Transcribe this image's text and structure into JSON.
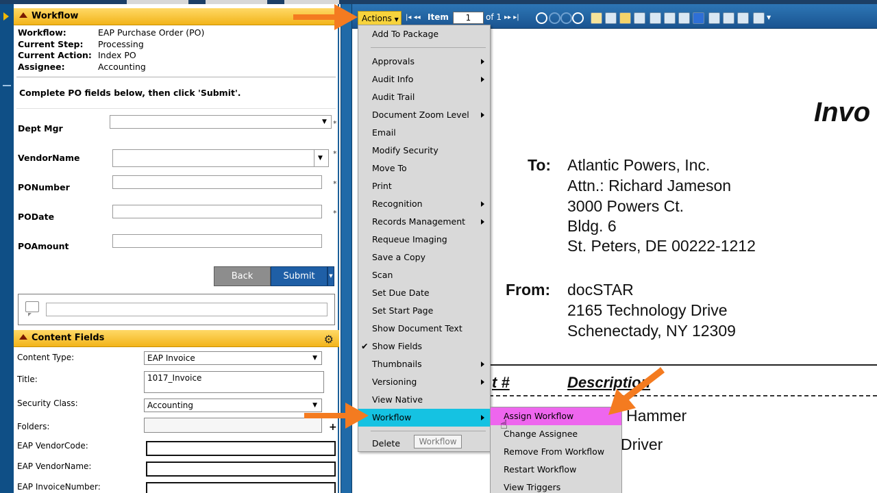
{
  "colors": {
    "accent_gold": "#f2b41a",
    "brand_blue": "#1f5fa6",
    "menu_highlight": "#15c2e2",
    "submenu_highlight": "#ee66ee",
    "arrow_orange": "#f47b20"
  },
  "workflow_panel": {
    "title": "Workflow",
    "info": [
      {
        "key": "Workflow:",
        "value": "EAP Purchase Order (PO)"
      },
      {
        "key": "Current Step:",
        "value": "Processing"
      },
      {
        "key": "Current Action:",
        "value": "Index PO"
      },
      {
        "key": "Assignee:",
        "value": "Accounting"
      }
    ],
    "instruction": "Complete PO fields below, then click 'Submit'.",
    "fields": [
      {
        "label": "Dept Mgr",
        "value": ""
      },
      {
        "label": "VendorName",
        "value": ""
      },
      {
        "label": "PONumber",
        "value": ""
      },
      {
        "label": "PODate",
        "value": ""
      },
      {
        "label": "POAmount",
        "value": ""
      }
    ],
    "required_mark": "*",
    "back_label": "Back",
    "submit_label": "Submit",
    "comment_value": ""
  },
  "content_panel": {
    "title": "Content Fields",
    "fields": [
      {
        "label": "Content Type:",
        "value": "EAP Invoice"
      },
      {
        "label": "Title:",
        "value": "1017_Invoice"
      },
      {
        "label": "Security Class:",
        "value": "Accounting"
      },
      {
        "label": "Folders:",
        "value": ""
      },
      {
        "label": "EAP VendorCode:",
        "value": ""
      },
      {
        "label": "EAP VendorName:",
        "value": ""
      },
      {
        "label": "EAP InvoiceNumber:",
        "value": ""
      }
    ],
    "plus_label": "+"
  },
  "toolbar": {
    "actions_label": "Actions",
    "first_prev": "|◂ ◂◂",
    "item_label": "Item",
    "page_value": "1",
    "of_label": "of 1",
    "next_last": "▸▸ ▸|"
  },
  "actions_menu": {
    "items": [
      {
        "label": "Add To Package",
        "sub": false
      },
      {
        "label": "Approvals",
        "sub": true
      },
      {
        "label": "Audit Info",
        "sub": true
      },
      {
        "label": "Audit Trail",
        "sub": false
      },
      {
        "label": "Document Zoom Level",
        "sub": true
      },
      {
        "label": "Email",
        "sub": false
      },
      {
        "label": "Modify Security",
        "sub": false
      },
      {
        "label": "Move To",
        "sub": false
      },
      {
        "label": "Print",
        "sub": false
      },
      {
        "label": "Recognition",
        "sub": true
      },
      {
        "label": "Records Management",
        "sub": true
      },
      {
        "label": "Requeue Imaging",
        "sub": false
      },
      {
        "label": "Save a Copy",
        "sub": false
      },
      {
        "label": "Scan",
        "sub": false
      },
      {
        "label": "Set Due Date",
        "sub": false
      },
      {
        "label": "Set Start Page",
        "sub": false
      },
      {
        "label": "Show Document Text",
        "sub": false
      },
      {
        "label": "Show Fields",
        "sub": false,
        "checked": true
      },
      {
        "label": "Thumbnails",
        "sub": true
      },
      {
        "label": "Versioning",
        "sub": true
      },
      {
        "label": "View Native",
        "sub": false
      },
      {
        "label": "Workflow",
        "sub": true,
        "highlighted": true
      },
      {
        "label": "Delete",
        "sub": false
      }
    ],
    "check_mark": "✔",
    "tooltip": "Workflow"
  },
  "workflow_submenu": {
    "items": [
      {
        "label": "Assign Workflow",
        "highlighted": true
      },
      {
        "label": "Change Assignee"
      },
      {
        "label": "Remove From Workflow"
      },
      {
        "label": "Restart Workflow"
      },
      {
        "label": "View Triggers"
      }
    ]
  },
  "document": {
    "title": "Invo",
    "to_label": "To:",
    "to_lines": [
      "Atlantic Powers, Inc.",
      "Attn.: Richard Jameson",
      "3000 Powers Ct.",
      "Bldg. 6",
      "St. Peters, DE  00222-1212"
    ],
    "from_label": "From:",
    "from_lines": [
      "docSTAR",
      "2165 Technology Drive",
      "Schenectady, NY 12309"
    ],
    "col_item": "t #",
    "col_desc": "Description",
    "line_items": [
      "Hammer",
      "Driver"
    ]
  }
}
